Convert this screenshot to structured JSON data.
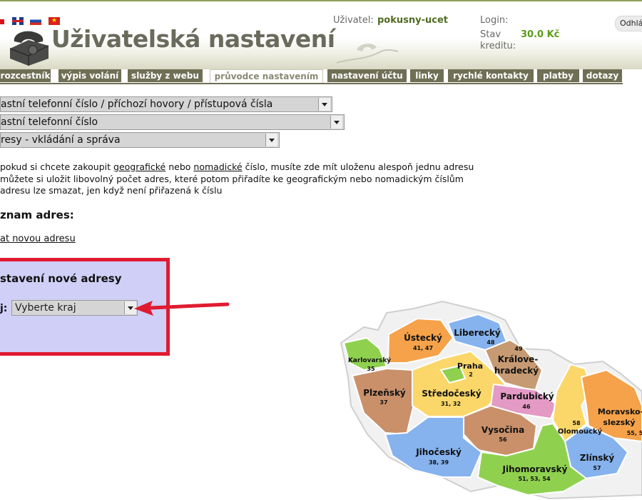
{
  "header": {
    "title": "Uživatelská nastavení",
    "user_label": "Uživatel:",
    "user_value": "pokusny-ucet",
    "login_label": "Login:",
    "credit_label_1": "Stav",
    "credit_label_2": "kreditu:",
    "credit_value": "30.0 Kč",
    "logout_label": "Odhlá",
    "flags": [
      "cz",
      "uk",
      "ru",
      "vn"
    ]
  },
  "tabs": [
    {
      "label": "rozcestník",
      "active": false
    },
    {
      "label": "výpis volání",
      "active": false
    },
    {
      "label": "služby z webu",
      "active": false
    },
    {
      "label": "průvodce nastavením",
      "active": true
    },
    {
      "label": "nastavení účtu",
      "active": false
    },
    {
      "label": "linky",
      "active": false
    },
    {
      "label": "rychlé kontakty",
      "active": false
    },
    {
      "label": "platby",
      "active": false
    },
    {
      "label": "dotazy",
      "active": false
    }
  ],
  "selects": {
    "level1": "astní telefonní číslo / příchozí hovory / přístupová čísla",
    "level2": "astní telefonní číslo",
    "level3": "resy - vkládání a správa"
  },
  "info": {
    "line1_a": "pokud si chcete zakoupit ",
    "line1_b": "geografické",
    "line1_c": " nebo ",
    "line1_d": "nomadické",
    "line1_e": " číslo, musíte zde mít uloženu alespoň jednu adresu",
    "line2": "můžete si uložit libovolný počet adres, které potom přiřadíte ke geografickým nebo nomadickým číslům",
    "line3": "adresu lze smazat, jen když není přiřazená k číslu"
  },
  "list_title": "znam adres:",
  "new_address_link": "at novou adresu",
  "panel": {
    "title": "stavení nové adresy",
    "kraj_label": "j:",
    "kraj_value": "Vyberte kraj"
  },
  "colors": {
    "tab_bg": "#6f6f56",
    "panel_bg": "#cfcff7",
    "panel_border": "#e01b30",
    "arrow": "#e01b30"
  },
  "map": {
    "regions": [
      {
        "name": "Karlovarský",
        "code": "35",
        "color": "#8fd14f"
      },
      {
        "name": "Ústecký",
        "code": "41, 47",
        "color": "#f5a24a"
      },
      {
        "name": "Liberecký",
        "code": "48",
        "color": "#86b3ee"
      },
      {
        "name": "Královehradecký",
        "line1": "Králove-",
        "line2": "hradecký",
        "code": "49",
        "color": "#c69a72"
      },
      {
        "name": "Praha",
        "code": "2",
        "color": "#8fd14f"
      },
      {
        "name": "Plzeňský",
        "code": "37",
        "color": "#c9906a"
      },
      {
        "name": "Středočeský",
        "code": "31, 32",
        "color": "#fbd76a"
      },
      {
        "name": "Pardubický",
        "code": "46",
        "color": "#e39ac4"
      },
      {
        "name": "Vysočina",
        "code": "56",
        "color": "#c9906a"
      },
      {
        "name": "Jihočeský",
        "code": "38, 39",
        "color": "#86b3ee"
      },
      {
        "name": "Olomoucký",
        "code": "58",
        "color": "#fbd76a"
      },
      {
        "name": "Moravskoslezský",
        "line1": "Moravsko-",
        "line2": "slezský",
        "code": "55, 5",
        "color": "#f5a24a"
      },
      {
        "name": "Zlínský",
        "code": "57",
        "color": "#86b3ee"
      },
      {
        "name": "Jihomoravský",
        "code": "51, 53, 54",
        "color": "#8fd14f"
      }
    ]
  }
}
